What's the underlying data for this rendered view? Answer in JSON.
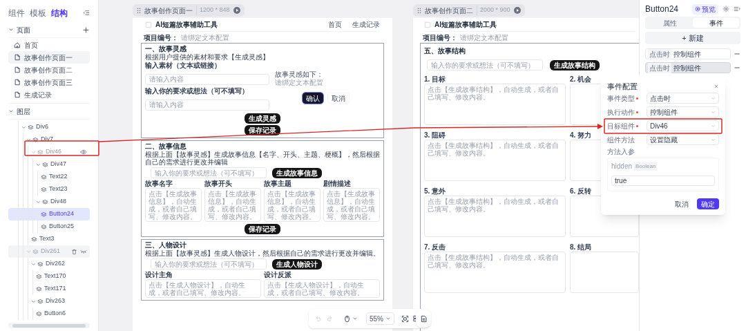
{
  "sidebar": {
    "tabs": [
      {
        "label": "组件",
        "selected": false
      },
      {
        "label": "模板",
        "selected": false
      },
      {
        "label": "结构",
        "selected": true
      }
    ],
    "pages": {
      "title": "页面",
      "items": [
        {
          "label": "首页",
          "kind": "home",
          "selected": false
        },
        {
          "label": "故事创作页面一",
          "kind": "page",
          "selected": true
        },
        {
          "label": "故事创作页面二",
          "kind": "page",
          "selected": false
        },
        {
          "label": "故事创作页面三",
          "kind": "page",
          "selected": false
        },
        {
          "label": "生成记录",
          "kind": "page",
          "selected": false
        }
      ]
    },
    "layers": {
      "title": "图层",
      "tree": [
        {
          "label": "Div6",
          "selected": false,
          "hidden": false,
          "hovered": false,
          "children": [
            {
              "label": "Div7",
              "selected": false,
              "hidden": false,
              "hovered": false,
              "children": [
                {
                  "label": "Div46",
                  "selected": false,
                  "hidden": true,
                  "hovered": false,
                  "children": [
                    {
                      "label": "Div47",
                      "selected": false,
                      "hidden": false,
                      "hovered": false,
                      "children": [
                        {
                          "label": "Text22",
                          "selected": false,
                          "hidden": false,
                          "hovered": false
                        },
                        {
                          "label": "Text23",
                          "selected": false,
                          "hidden": false,
                          "hovered": false
                        }
                      ]
                    },
                    {
                      "label": "Div48",
                      "selected": false,
                      "hidden": false,
                      "hovered": false,
                      "children": [
                        {
                          "label": "Button24",
                          "selected": true,
                          "hidden": false,
                          "hovered": false
                        },
                        {
                          "label": "Button25",
                          "selected": false,
                          "hidden": false,
                          "hovered": false
                        }
                      ]
                    }
                  ]
                },
                {
                  "label": "Text3",
                  "selected": false,
                  "hidden": false,
                  "hovered": false
                }
              ]
            },
            {
              "label": "Div261",
              "selected": false,
              "hidden": true,
              "hovered": true,
              "children": [
                {
                  "label": "Div262",
                  "selected": false,
                  "hidden": false,
                  "hovered": false,
                  "children": [
                    {
                      "label": "Text170",
                      "selected": false,
                      "hidden": false,
                      "hovered": false
                    },
                    {
                      "label": "Text171",
                      "selected": false,
                      "hidden": false,
                      "hovered": false
                    }
                  ]
                },
                {
                  "label": "Div263",
                  "selected": false,
                  "hidden": false,
                  "hovered": false,
                  "children": [
                    {
                      "label": "Button6",
                      "selected": false,
                      "hidden": false,
                      "hovered": false
                    }
                  ]
                }
              ]
            }
          ]
        }
      ]
    }
  },
  "artboard_1": {
    "title": "故事创作页面一",
    "size": "1200 * 848",
    "app_title": "AI短篇故事辅助工具",
    "nav": [
      "首页",
      "生成记录"
    ],
    "project_label": "项目编号：",
    "project_value": "请绑定文本配置",
    "sections": [
      {
        "kind": "inspiration",
        "title": "一、故事灵感",
        "description": "根据用户提供的素材和要求【生成灵感】",
        "inputs": [
          {
            "label": "输入素材（文本或链接）",
            "placeholder": "请输入内容"
          },
          {
            "label": "输入你的要求或想法（可不填写）",
            "placeholder": "请输入内容"
          }
        ],
        "result_label": "故事灵感如下：",
        "result_value": "请绑定文本配置",
        "choice_buttons": [
          {
            "label": "确认",
            "selected": true
          },
          {
            "label": "取消",
            "selected": false
          }
        ],
        "generate_button": "生成灵感",
        "save_button": "保存记录"
      },
      {
        "kind": "generator",
        "title": "二、故事信息",
        "description": "根据上面【故事灵感】生成故事信息【名字、开头、主题、梗概】，然后根据自己的需求进行更改并编辑",
        "prompt_placeholder": "输入你的要求或想法（可不填写）",
        "generate_button": "生成故事信息",
        "fields": [
          {
            "label": "故事名字",
            "placeholder": "点击【生成故事信息】，自动生成，或者自己填写、修改内容。"
          },
          {
            "label": "故事开头",
            "placeholder": "点击【生成故事信息】，自动生成，或者自己填写、修改内容。"
          },
          {
            "label": "故事主题",
            "placeholder": "点击【生成故事信息】，自动生成，或者自己填写、修改内容。"
          },
          {
            "label": "剧情描述",
            "placeholder": "点击【生成故事信息】，自动生成，或者自己填写、修改内容。"
          }
        ],
        "save_button": "保存记录"
      },
      {
        "kind": "generator",
        "title": "三、人物设计",
        "description": "根据上面【故事灵感】生成人物设计，然后根据自己的需求进行更改并编辑。",
        "prompt_placeholder": "输入你的要求或想法（可不填写）",
        "generate_button": "生成人物设计",
        "fields": [
          {
            "label": "设计主角",
            "placeholder": "点击【生成人物设计】，自动生成，或者自己填写、修改内容。"
          },
          {
            "label": "设计反派",
            "placeholder": "点击【生成人物设计】，自动生成，或者自己填写、修改内容。"
          }
        ]
      }
    ]
  },
  "artboard_2": {
    "title": "故事创作页面二",
    "size": "2000 * 900",
    "app_title": "AI短篇故事辅助工具",
    "project_label": "项目编号：",
    "project_value": "请绑定文本配置",
    "section": {
      "title": "五、故事结构",
      "prompt_placeholder": "输入你的要求或想法（可不填写）",
      "generate_button": "生成故事结构",
      "items": [
        {
          "label": "1. 目标",
          "placeholder": "点击【生成故事结构】，自动生成，或者自己填写、修改内容。"
        },
        {
          "label": "2. 机会"
        },
        {
          "label": "3. 阻碍",
          "placeholder": "点击【生成故事结构】，自动生成，或者自己填写、修改内容。"
        },
        {
          "label": "4. 努力"
        },
        {
          "label": "5. 意外",
          "placeholder": "点击【生成故事结构】，自动生成，或者自己填写、修改内容。"
        },
        {
          "label": "6. 反转"
        },
        {
          "label": "7. 反击",
          "placeholder": "点击【生成故事结构】，自动生成，或者自己填写、修改内容。"
        },
        {
          "label": "8. 结局"
        }
      ]
    }
  },
  "toolbar": {
    "zoom": "55%"
  },
  "inspector": {
    "title": "Button24",
    "preview_button": "预览",
    "tabs": [
      {
        "label": "属性",
        "selected": false
      },
      {
        "label": "事件",
        "selected": true
      }
    ],
    "new_button": "+ 新建",
    "events": [
      {
        "trigger": "点击时",
        "action": "控制组件",
        "selected": false
      },
      {
        "trigger": "点击时",
        "action": "控制组件",
        "selected": true
      }
    ]
  },
  "dialog": {
    "title": "事件配置",
    "fields": [
      {
        "label": "事件类型",
        "required": true,
        "value": "点击时"
      },
      {
        "label": "执行动作",
        "required": true,
        "value": "控制组件"
      },
      {
        "label": "目标组件",
        "required": true,
        "value": "Div46"
      },
      {
        "label": "组件方法",
        "required": false,
        "value": "设置隐藏"
      }
    ],
    "params_label": "方法入参",
    "param": {
      "name": "hidden",
      "type": "Boolean",
      "value": "true"
    },
    "buttons": [
      {
        "label": "取消",
        "kind": "secondary"
      },
      {
        "label": "确定",
        "kind": "primary"
      }
    ]
  }
}
